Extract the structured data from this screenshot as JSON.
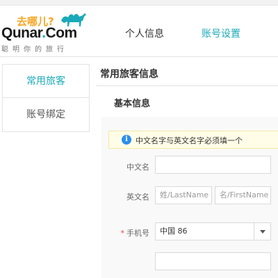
{
  "logo": {
    "slogan": "去哪儿?",
    "brand_main": "Qunar",
    "brand_dot": ".",
    "brand_com": "Com",
    "tagline": "聪明你的旅行",
    "brand_color": "#1ba9ba",
    "slogan_color": "#f5a623"
  },
  "nav": {
    "personal_info": "个人信息",
    "account_settings": "账号设置",
    "active": "account_settings"
  },
  "sidebar": {
    "items": [
      {
        "label": "常用旅客",
        "active": true
      },
      {
        "label": "账号绑定",
        "active": false
      }
    ]
  },
  "main": {
    "title": "常用旅客信息",
    "section_title": "基本信息",
    "notice": {
      "icon": "info-icon",
      "text": "中文名字与英文名字必须填一个"
    },
    "form": {
      "chinese_name_label": "中文名",
      "chinese_name_value": "",
      "english_name_label": "英文名",
      "last_name_placeholder": "姓/LastName",
      "first_name_placeholder": "名/FirstName",
      "phone_label": "手机号",
      "required_mark": "*",
      "country_code_value": "中国 86",
      "phone_value": ""
    }
  }
}
